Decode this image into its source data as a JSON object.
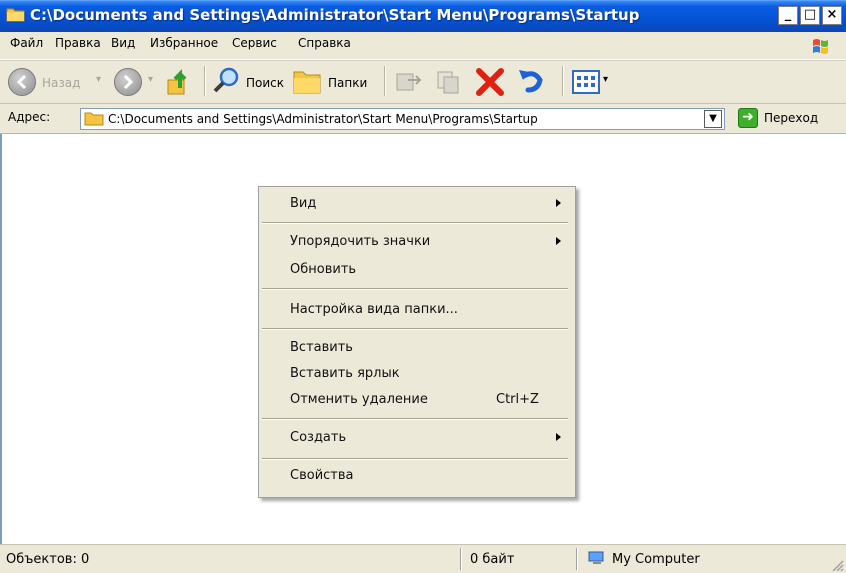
{
  "window": {
    "title": "C:\\Documents and Settings\\Administrator\\Start Menu\\Programs\\Startup",
    "buttons": {
      "minimize": "_",
      "maximize": "□",
      "close": "×"
    }
  },
  "menubar": {
    "items": [
      "Файл",
      "Правка",
      "Вид",
      "Избранное",
      "Сервис",
      "Справка"
    ]
  },
  "toolbar": {
    "back_label": "Назад",
    "search_label": "Поиск",
    "folders_label": "Папки"
  },
  "address": {
    "label": "Адрес:",
    "value": "C:\\Documents and Settings\\Administrator\\Start Menu\\Programs\\Startup",
    "go_label": "Переход"
  },
  "context_menu": {
    "items": [
      {
        "label": "Вид",
        "submenu": true
      },
      {
        "label": "Упорядочить значки",
        "submenu": true
      },
      {
        "label": "Обновить"
      },
      {
        "label": "Настройка вида папки..."
      },
      {
        "label": "Вставить"
      },
      {
        "label": "Вставить ярлык"
      },
      {
        "label": "Отменить удаление",
        "shortcut": "Ctrl+Z"
      },
      {
        "label": "Создать",
        "submenu": true
      },
      {
        "label": "Свойства"
      }
    ]
  },
  "statusbar": {
    "objects": "Объектов: 0",
    "size": "0 байт",
    "zone": "My Computer"
  },
  "colors": {
    "title_blue": "#0553d6",
    "chrome_beige": "#ece9d8",
    "go_green": "#3fae2a",
    "delete_red": "#e02010"
  }
}
